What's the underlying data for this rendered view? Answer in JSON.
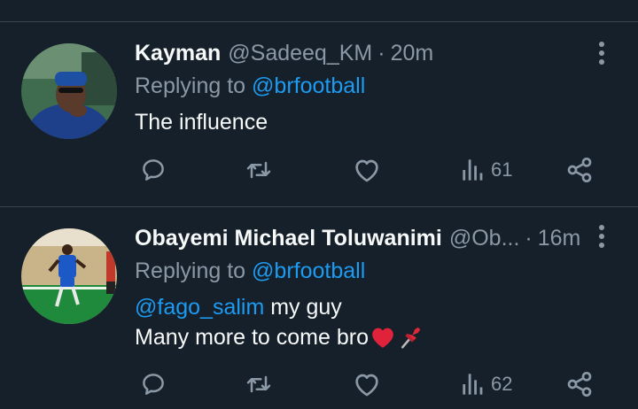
{
  "tweets": [
    {
      "name": "Kayman",
      "handle": "@Sadeeq_KM",
      "separator": "·",
      "time": "20m",
      "replying_prefix": "Replying to",
      "replying_to": "@brfootball",
      "text_lines": [
        "The influence"
      ],
      "views": "61"
    },
    {
      "name": "Obayemi Michael Toluwanimi",
      "handle": "@Ob...",
      "separator": "·",
      "time": "16m",
      "replying_prefix": "Replying to",
      "replying_to": "@brfootball",
      "mention": "@fago_salim",
      "text_after_mention": " my guy",
      "text_line2": "Many more to come bro",
      "emojis": [
        "red-heart",
        "pushpin"
      ],
      "views": "62"
    }
  ],
  "colors": {
    "background": "#15202b",
    "divider": "#38444d",
    "secondary_text": "#8b98a5",
    "link": "#1d9bf0",
    "primary_text": "#f7f9f9"
  }
}
